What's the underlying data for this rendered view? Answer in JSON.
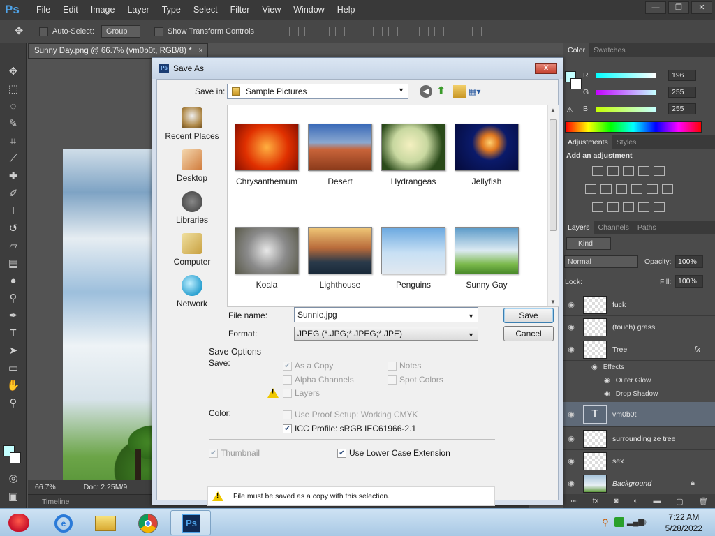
{
  "app": {
    "logo": "Ps",
    "menu": [
      "File",
      "Edit",
      "Image",
      "Layer",
      "Type",
      "Select",
      "Filter",
      "View",
      "Window",
      "Help"
    ]
  },
  "options_bar": {
    "auto_select_label": "Auto-Select:",
    "auto_select_value": "Group",
    "transform_label": "Show Transform Controls"
  },
  "document": {
    "tab_title": "Sunny Day.png @ 66.7% (vm0b0t, RGB/8) *",
    "close_glyph": "×",
    "zoom": "66.7%",
    "doc_info": "Doc: 2.25M/9",
    "timeline_label": "Timeline"
  },
  "panels": {
    "color_tabs": [
      "Color",
      "Swatches"
    ],
    "color": {
      "r_label": "R",
      "g_label": "G",
      "b_label": "B",
      "r": "196",
      "g": "255",
      "b": "255",
      "r_fill": 0.77,
      "g_fill": 1.0,
      "b_fill": 1.0,
      "foreground": "#c4ffff"
    },
    "adj_tabs": [
      "Adjustments",
      "Styles"
    ],
    "adj_title": "Add an adjustment",
    "layer_tabs": [
      "Layers",
      "Channels",
      "Paths"
    ],
    "layer_filter": "Kind",
    "blend_mode": "Normal",
    "opacity_label": "Opacity:",
    "opacity": "100%",
    "lock_label": "Lock:",
    "fill_label": "Fill:",
    "fill": "100%",
    "layers": [
      {
        "name": "fuck"
      },
      {
        "name": "(touch) grass"
      },
      {
        "name": "Tree",
        "fx": "fx"
      },
      {
        "name": "vm0b0t",
        "type": "T"
      },
      {
        "name": "surrounding ze tree"
      },
      {
        "name": "sex"
      },
      {
        "name": "Background"
      }
    ],
    "effects_label": "Effects",
    "effects": [
      "Outer Glow",
      "Drop Shadow"
    ]
  },
  "dialog": {
    "title": "Save As",
    "close_glyph": "X",
    "save_in_label": "Save in:",
    "save_in_value": "Sample Pictures",
    "places": [
      "Recent Places",
      "Desktop",
      "Libraries",
      "Computer",
      "Network"
    ],
    "files": [
      "Chrysanthemum",
      "Desert",
      "Hydrangeas",
      "Jellyfish",
      "Koala",
      "Lighthouse",
      "Penguins",
      "Sunny Gay"
    ],
    "file_name_label": "File name:",
    "file_name_value": "Sunnie.jpg",
    "format_label": "Format:",
    "format_value": "JPEG (*.JPG;*.JPEG;*.JPE)",
    "save_button": "Save",
    "cancel_button": "Cancel",
    "save_options_title": "Save Options",
    "save_label": "Save:",
    "as_copy": "As a Copy",
    "notes": "Notes",
    "alpha_channels": "Alpha Channels",
    "spot_colors": "Spot Colors",
    "layers": "Layers",
    "color_label": "Color:",
    "proof_setup": "Use Proof Setup:  Working CMYK",
    "icc_profile": "ICC Profile:  sRGB IEC61966-2.1",
    "thumbnail": "Thumbnail",
    "lower_case_ext": "Use Lower Case Extension",
    "warning_text": "File must be saved as a copy with this selection."
  },
  "taskbar": {
    "time": "7:22 AM",
    "date": "5/28/2022"
  }
}
